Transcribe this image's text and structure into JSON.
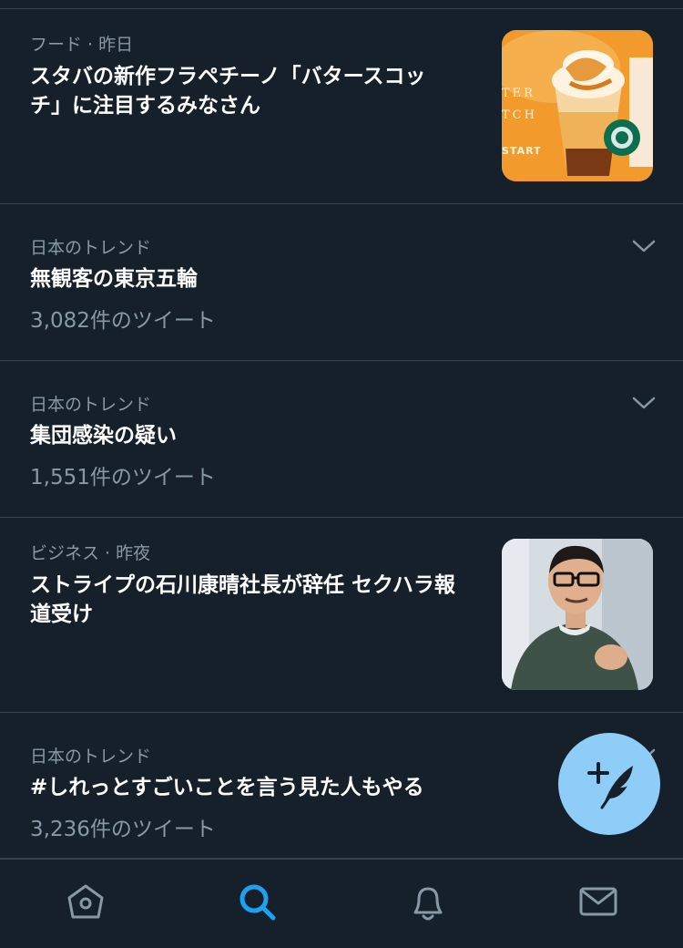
{
  "items": [
    {
      "meta": "フード · 昨日",
      "headline_line1": "スタバの新作フラペチーノ「バタースコッ",
      "headline_line2": "チ」に注目するみなさん",
      "thumb_text_lines": [
        "TER",
        "TCH",
        "START"
      ],
      "thumb_icon": "frappuccino-image"
    },
    {
      "meta": "日本のトレンド",
      "headline_line1": "無観客の東京五輪",
      "count": "3,082件のツイート",
      "menu_icon": "chevron-down-icon"
    },
    {
      "meta": "日本のトレンド",
      "headline_line1": "集団感染の疑い",
      "count": "1,551件のツイート",
      "menu_icon": "chevron-down-icon"
    },
    {
      "meta": "ビジネス · 昨夜",
      "headline_line1": "ストライプの石川康晴社長が辞任 セクハラ報",
      "headline_line2": "道受け",
      "thumb_icon": "person-photo"
    },
    {
      "meta": "日本のトレンド",
      "headline_line1": "#しれっとすごいことを言う見た人もやる",
      "count": "3,236件のツイート",
      "menu_icon": "chevron-down-icon"
    }
  ],
  "tabbar": {
    "tabs": [
      {
        "icon": "home-icon",
        "active": false
      },
      {
        "icon": "search-icon",
        "active": true
      },
      {
        "icon": "bell-icon",
        "active": false
      },
      {
        "icon": "mail-icon",
        "active": false
      }
    ]
  },
  "fab": {
    "icon": "compose-tweet-icon"
  },
  "colors": {
    "background": "#15202b",
    "divider": "#38444d",
    "secondary_text": "#8899a6",
    "accent": "#1da1f2",
    "fab": "#8ecdf8"
  }
}
